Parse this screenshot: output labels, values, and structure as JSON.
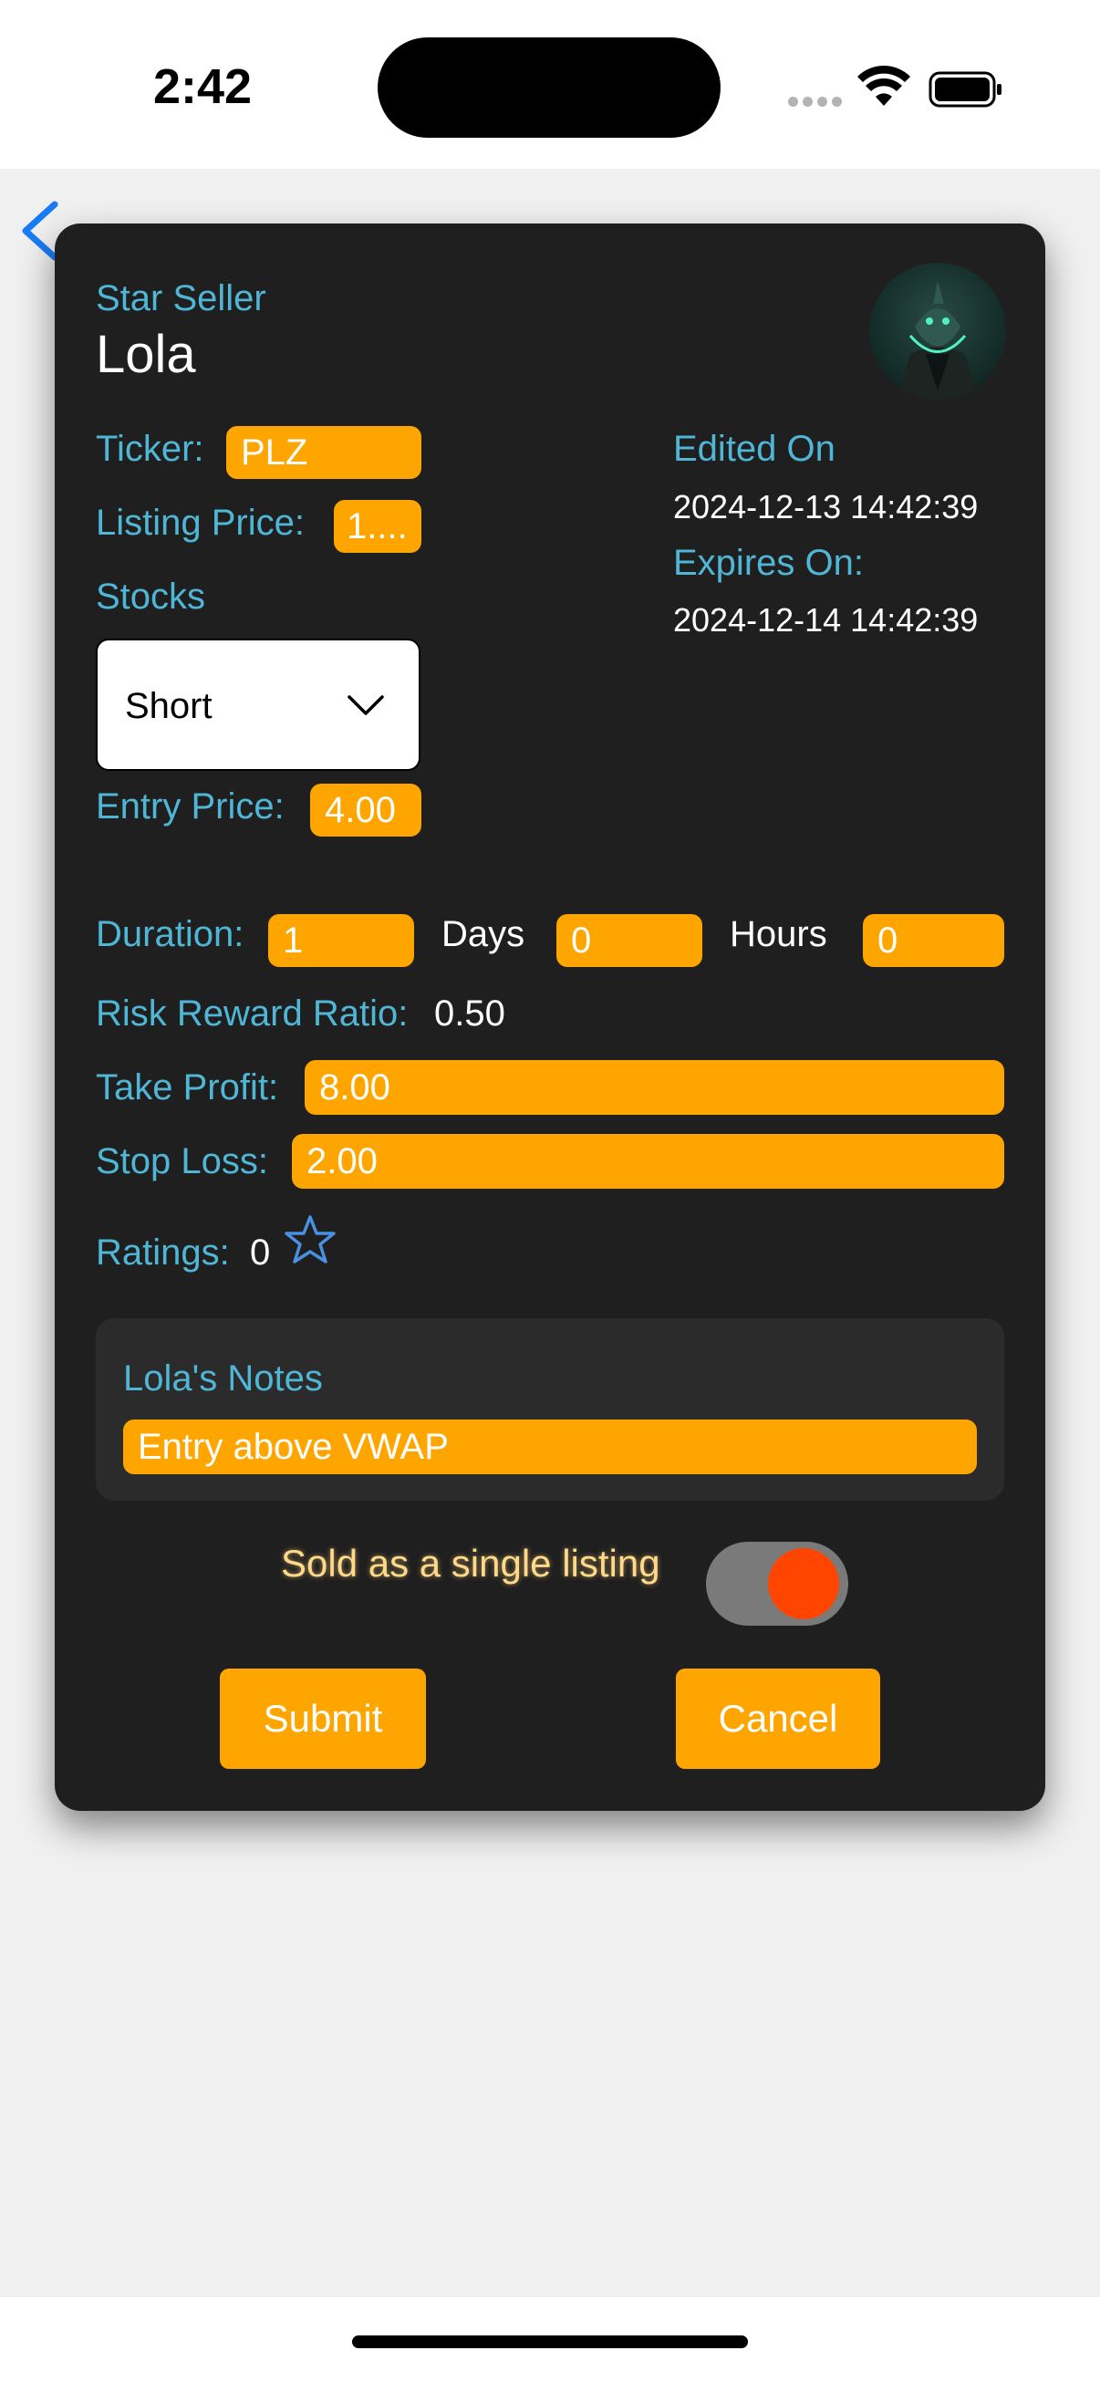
{
  "status_bar": {
    "time": "2:42"
  },
  "card": {
    "seller_label": "Star Seller",
    "seller_name": "Lola",
    "ticker_label": "Ticker:",
    "ticker_value": "PLZ",
    "listing_price_label": "Listing Price:",
    "listing_price_value": "1....",
    "stocks_label": "Stocks",
    "position_select": "Short",
    "entry_price_label": "Entry Price:",
    "entry_price_value": "4.00",
    "edited_on_label": "Edited On",
    "edited_on_value": "2024-12-13 14:42:39",
    "expires_on_label": "Expires On:",
    "expires_on_value": "2024-12-14 14:42:39",
    "duration_label": "Duration:",
    "duration_days_value": "1",
    "days_label": "Days",
    "duration_hours_value": "0",
    "hours_label": "Hours",
    "duration_minutes_value": "0",
    "risk_reward_label": "Risk Reward Ratio:",
    "risk_reward_value": "0.50",
    "take_profit_label": "Take Profit:",
    "take_profit_value": "8.00",
    "stop_loss_label": "Stop Loss:",
    "stop_loss_value": "2.00",
    "ratings_label": "Ratings:",
    "ratings_value": "0",
    "notes_title": "Lola's Notes",
    "notes_value": "Entry above VWAP",
    "single_listing_label": "Sold as a single listing",
    "single_listing_on": true,
    "submit_label": "Submit",
    "cancel_label": "Cancel"
  },
  "colors": {
    "accent_orange": "#ffa500",
    "label_cyan": "#4fb6d6",
    "card_bg": "#1f1f1f",
    "toggle_knob": "#ff4500",
    "ios_blue": "#1a7cf5"
  }
}
